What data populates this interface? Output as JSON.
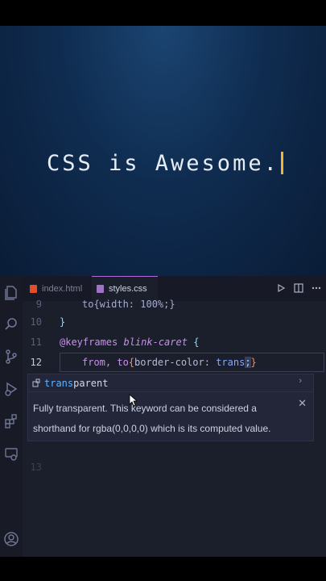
{
  "preview": {
    "text": "CSS is Awesome."
  },
  "tabs": [
    {
      "label": "index.html",
      "icon": "html-file-icon",
      "color": "#e44d26"
    },
    {
      "label": "styles.css",
      "icon": "css-file-icon",
      "color": "#a074c4"
    }
  ],
  "activity_bar": [
    "explorer-icon",
    "search-icon",
    "source-control-icon",
    "run-debug-icon",
    "extensions-icon",
    "remote-explorer-icon",
    "account-icon"
  ],
  "code": {
    "lines": [
      {
        "num": "9",
        "text": "to{width: 100%;}"
      },
      {
        "num": "10",
        "text": "}"
      },
      {
        "num": "11",
        "at": "@keyframes",
        "name": "blink-caret",
        "brace": "{"
      },
      {
        "num": "12",
        "kw": "from, to",
        "open": "{",
        "prop": "border-color: ",
        "val": "trans",
        "semi": ";",
        "close": "}"
      }
    ],
    "line13_num": "13"
  },
  "suggestion": {
    "match": "trans",
    "rest": "parent"
  },
  "docs": {
    "text": "Fully transparent. This keyword can be considered a shorthand for rgba(0,0,0,0) which is its computed value."
  },
  "colors": {
    "accent": "#b26ad9",
    "caret": "#f2b531",
    "background": "#1b1e2b"
  }
}
